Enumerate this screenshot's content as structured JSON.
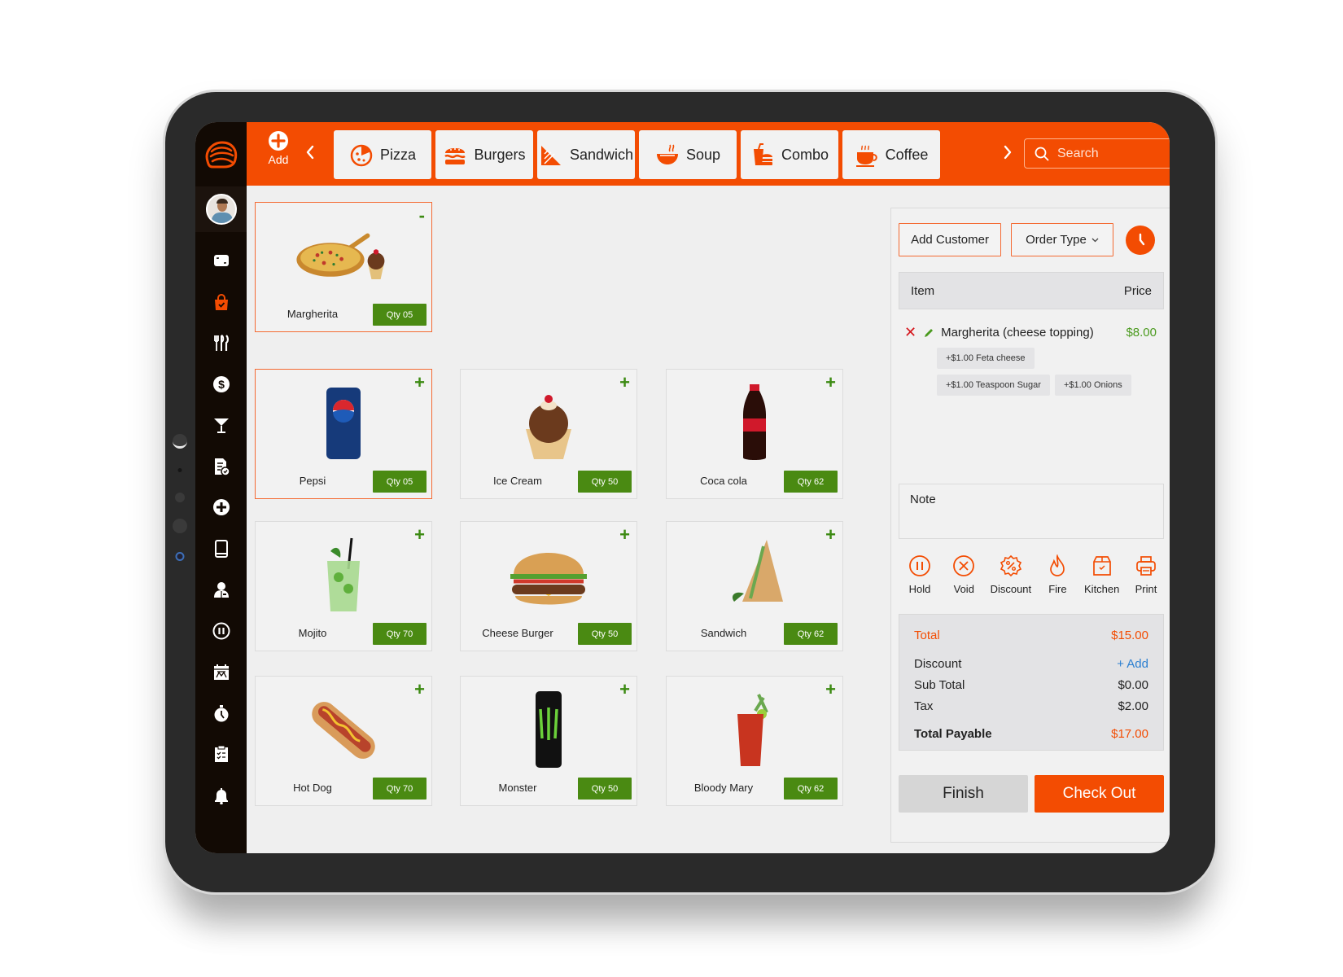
{
  "colors": {
    "brand": "#f34c02",
    "sidebar_bg": "#120a04",
    "qty_green": "#4a8a12",
    "price_green": "#4a9a1e",
    "link_blue": "#2b7fd1",
    "void_red": "#d5161d"
  },
  "header": {
    "add_label": "Add",
    "categories": [
      {
        "label": "Pizza",
        "icon": "pizza-icon"
      },
      {
        "label": "Burgers",
        "icon": "burger-icon"
      },
      {
        "label": "Sandwich",
        "icon": "sandwich-icon"
      },
      {
        "label": "Soup",
        "icon": "soup-icon"
      },
      {
        "label": "Combo",
        "icon": "combo-icon"
      },
      {
        "label": "Coffee",
        "icon": "coffee-icon"
      }
    ],
    "search_placeholder": "Search"
  },
  "sidebar": {
    "items": [
      {
        "icon": "expand-icon",
        "active": false
      },
      {
        "icon": "shopping-bag-icon",
        "active": true
      },
      {
        "icon": "cutlery-icon",
        "active": false
      },
      {
        "icon": "dollar-icon",
        "active": false
      },
      {
        "icon": "cocktail-icon",
        "active": false
      },
      {
        "icon": "document-check-icon",
        "active": false
      },
      {
        "icon": "plus-circle-icon",
        "active": false
      },
      {
        "icon": "tablet-icon",
        "active": false
      },
      {
        "icon": "chef-icon",
        "active": false
      },
      {
        "icon": "pause-circle-icon",
        "active": false
      },
      {
        "icon": "calendar-icon",
        "active": false
      },
      {
        "icon": "stopwatch-icon",
        "active": false
      },
      {
        "icon": "clipboard-icon",
        "active": false
      },
      {
        "icon": "bell-icon",
        "active": false
      }
    ]
  },
  "products": {
    "featured": {
      "name": "Margherita",
      "qty": "Qty 05",
      "corner": "-",
      "selected": true
    },
    "grid": [
      {
        "name": "Pepsi",
        "qty": "Qty 05",
        "corner": "+",
        "selected": true
      },
      {
        "name": "Ice Cream",
        "qty": "Qty 50",
        "corner": "+",
        "selected": false
      },
      {
        "name": "Coca cola",
        "qty": "Qty 62",
        "corner": "+",
        "selected": false
      },
      {
        "name": "Mojito",
        "qty": "Qty 70",
        "corner": "+",
        "selected": false
      },
      {
        "name": "Cheese Burger",
        "qty": "Qty 50",
        "corner": "+",
        "selected": false
      },
      {
        "name": "Sandwich",
        "qty": "Qty 62",
        "corner": "+",
        "selected": false
      },
      {
        "name": "Hot Dog",
        "qty": "Qty 70",
        "corner": "+",
        "selected": false
      },
      {
        "name": "Monster",
        "qty": "Qty 50",
        "corner": "+",
        "selected": false
      },
      {
        "name": "Bloody Mary",
        "qty": "Qty 62",
        "corner": "+",
        "selected": false
      }
    ]
  },
  "order": {
    "add_customer": "Add Customer",
    "order_type": "Order Type",
    "columns": {
      "item": "Item",
      "price": "Price"
    },
    "items": [
      {
        "name": "Margherita (cheese topping)",
        "price": "$8.00",
        "modifiers": [
          "+$1.00 Feta cheese",
          "+$1.00 Teaspoon Sugar",
          "+$1.00 Onions"
        ]
      }
    ],
    "note_label": "Note",
    "actions": [
      {
        "label": "Hold",
        "icon": "pause-circle-icon"
      },
      {
        "label": "Void",
        "icon": "x-circle-icon"
      },
      {
        "label": "Discount",
        "icon": "discount-badge-icon"
      },
      {
        "label": "Fire",
        "icon": "fire-icon"
      },
      {
        "label": "Kitchen",
        "icon": "kitchen-box-icon"
      },
      {
        "label": "Print",
        "icon": "printer-icon"
      }
    ],
    "totals": {
      "total_label": "Total",
      "total_value": "$15.00",
      "discount_label": "Discount",
      "discount_action": "+ Add",
      "subtotal_label": "Sub Total",
      "subtotal_value": "$0.00",
      "tax_label": "Tax",
      "tax_value": "$2.00",
      "payable_label": "Total Payable",
      "payable_value": "$17.00"
    },
    "finish_label": "Finish",
    "checkout_label": "Check Out"
  }
}
